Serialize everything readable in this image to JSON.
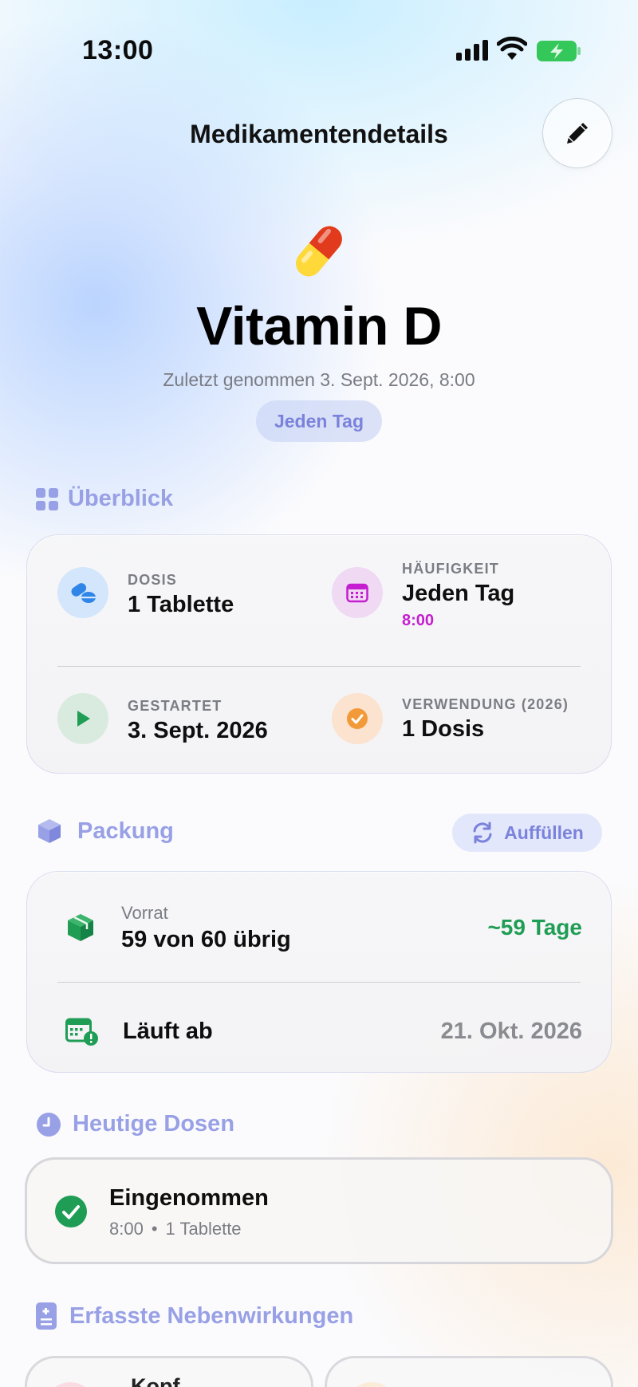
{
  "status_bar": {
    "time": "13:00"
  },
  "header": {
    "title": "Medikamentendetails"
  },
  "medication": {
    "name": "Vitamin D",
    "last_taken": "Zuletzt genommen 3. Sept. 2026, 8:00",
    "frequency_chip": "Jeden Tag"
  },
  "overview": {
    "title": "Überblick",
    "dose_label": "DOSIS",
    "dose_value": "1 Tablette",
    "frequency_label": "HÄUFIGKEIT",
    "frequency_value": "Jeden Tag",
    "frequency_time": "8:00",
    "started_label": "GESTARTET",
    "started_value": "3. Sept. 2026",
    "usage_label": "VERWENDUNG (2026)",
    "usage_value": "1 Dosis"
  },
  "pack": {
    "title": "Packung",
    "refill_label": "Auffüllen",
    "supply_label": "Vorrat",
    "supply_value": "59 von 60 übrig",
    "supply_days": "~59 Tage",
    "expiry_label": "Läuft ab",
    "expiry_value": "21. Okt. 2026"
  },
  "today": {
    "title": "Heutige Dosen",
    "status": "Eingenommen",
    "time": "8:00",
    "amount": "1 Tablette"
  },
  "side_effects": {
    "title": "Erfasste Nebenwirkungen",
    "items": [
      {
        "label": "Kopf"
      }
    ]
  },
  "colors": {
    "accent": "#98a0e6",
    "green": "#1f9d55",
    "magenta": "#c41ed0",
    "orange": "#f29a3a",
    "blue": "#2f86e8"
  }
}
